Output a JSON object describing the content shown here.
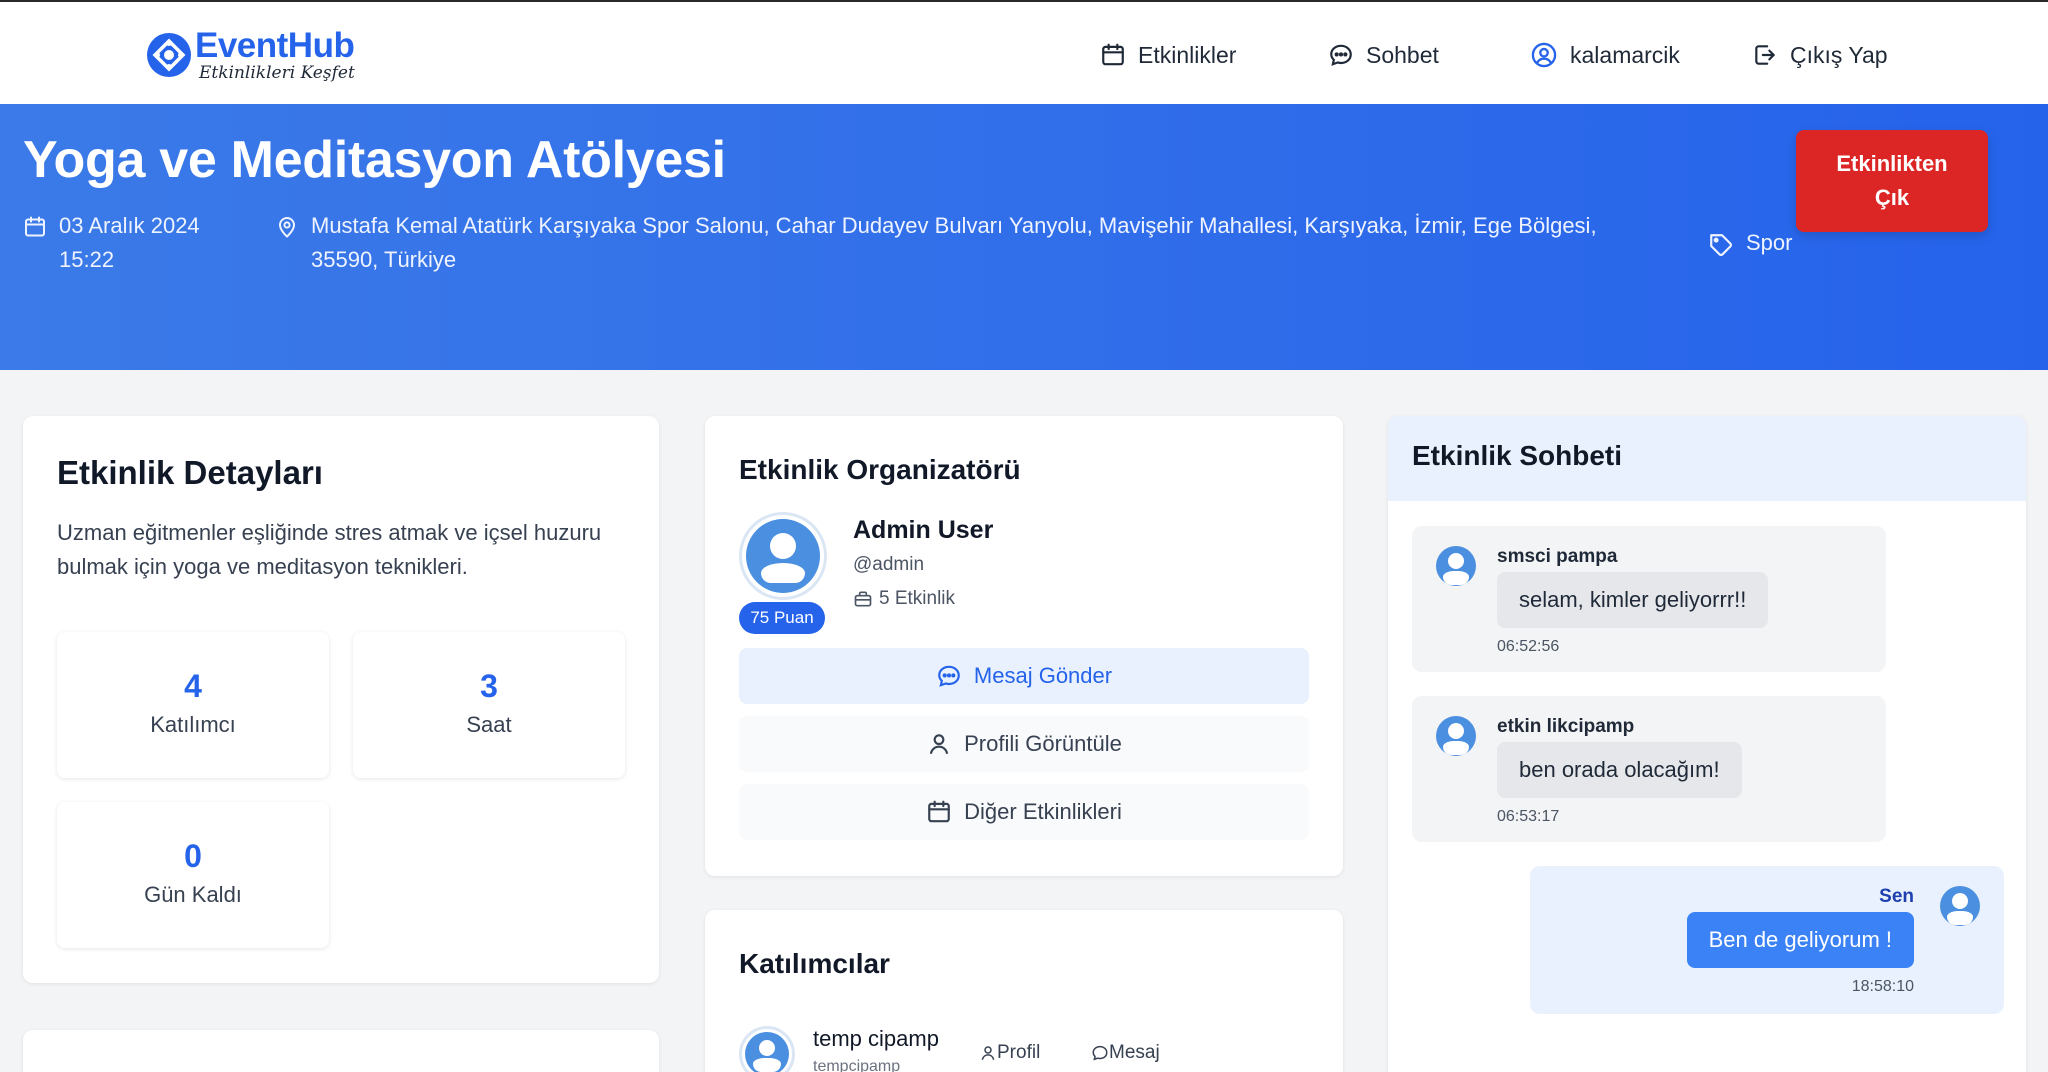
{
  "nav": {
    "brand": "EventHub",
    "tagline": "Etkinlikleri Keşfet",
    "events": "Etkinlikler",
    "chat": "Sohbet",
    "username": "kalamarcik",
    "logout": "Çıkış Yap"
  },
  "event": {
    "title": "Yoga ve Meditasyon Atölyesi",
    "date": "03 Aralık 2024",
    "time": "15:22",
    "address_line1": "Mustafa Kemal Atatürk Karşıyaka Spor Salonu, Cahar Dudayev Bulvarı Yanyolu, Mavişehir Mahallesi, Karşıyaka, İzmir, Ege Bölgesi,",
    "address_line2": "35590, Türkiye",
    "category": "Spor",
    "leave_line1": "Etkinlikten",
    "leave_line2": "Çık"
  },
  "details": {
    "title": "Etkinlik Detayları",
    "desc_line1": "Uzman eğitmenler eşliğinde stres atmak ve içsel huzuru",
    "desc_line2": "bulmak için yoga ve meditasyon teknikleri.",
    "stats": [
      {
        "value": "4",
        "label": "Katılımcı"
      },
      {
        "value": "3",
        "label": "Saat"
      },
      {
        "value": "0",
        "label": "Gün Kaldı"
      }
    ]
  },
  "organizer": {
    "title": "Etkinlik Organizatörü",
    "name": "Admin User",
    "handle": "@admin",
    "events_count": "5 Etkinlik",
    "points": "75 Puan",
    "btn_message": "Mesaj Gönder",
    "btn_profile": "Profili Görüntüle",
    "btn_other": "Diğer Etkinlikleri"
  },
  "participants": {
    "title": "Katılımcılar",
    "items": [
      {
        "name": "temp cipamp",
        "handle": "tempcipamp",
        "profile": "Profil",
        "message": "Mesaj"
      }
    ]
  },
  "chat": {
    "title": "Etkinlik Sohbeti",
    "messages": [
      {
        "sender": "smsci pampa",
        "text": "selam, kimler geliyorrr!!",
        "time": "06:52:56"
      },
      {
        "sender": "etkin likcipamp",
        "text": "ben orada olacağım!",
        "time": "06:53:17"
      },
      {
        "sender": "Sen",
        "text": "Ben de geliyorum !",
        "time": "18:58:10"
      }
    ]
  },
  "colors": {
    "primary": "#2563eb",
    "danger": "#dc2626",
    "hero_start": "#3b7ae8",
    "light_blue": "#e8f1fd"
  }
}
